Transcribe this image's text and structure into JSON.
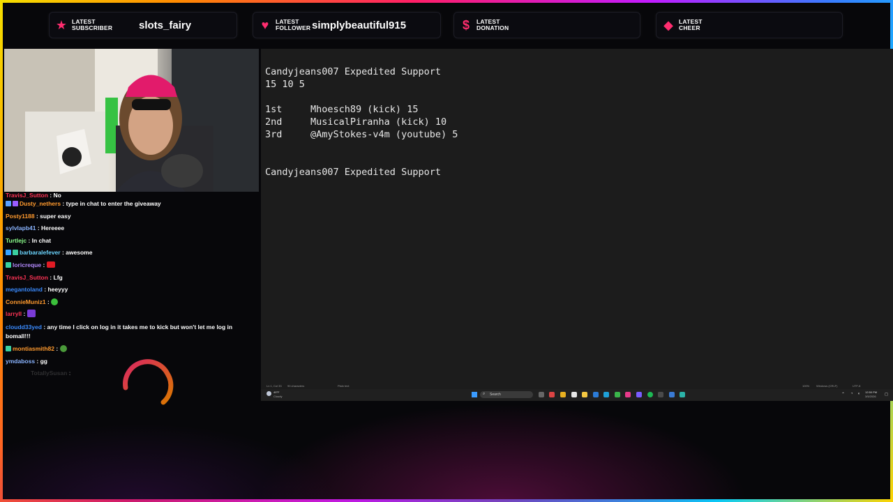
{
  "alerts": [
    {
      "icon": "star-icon",
      "label_line1": "LATEST",
      "label_line2": "SUBSCRIBER",
      "value": "slots_fairy"
    },
    {
      "icon": "heart-icon",
      "label_line1": "LATEST",
      "label_line2": "FOLLOWER",
      "value": "simplybeautiful915"
    },
    {
      "icon": "dollar-icon",
      "label_line1": "LATEST",
      "label_line2": "DONATION",
      "value": ""
    },
    {
      "icon": "diamond-icon",
      "label_line1": "LATEST",
      "label_line2": "CHEER",
      "value": ""
    }
  ],
  "chat": [
    {
      "user": "TravisJ_Sutton",
      "text": "No",
      "color": "#ff3355",
      "badges": []
    },
    {
      "user": "Dusty_nethers",
      "text": "type in chat to enter the giveaway",
      "color": "#ff9a2e",
      "badges": [
        "#5aa0ff",
        "#9b5cff"
      ]
    },
    {
      "user": "Posty1188",
      "text": "super easy",
      "color": "#ff9a2e",
      "badges": []
    },
    {
      "user": "sylvlapb41",
      "text": "Hereeee",
      "color": "#8ab4ff",
      "badges": []
    },
    {
      "user": "Turtlejc",
      "text": "In chat",
      "color": "#8cff8c",
      "badges": []
    },
    {
      "user": "barbaralefever",
      "text": "awesome",
      "color": "#6cd6ff",
      "badges": [
        "#36a3ff",
        "#3ad0a0"
      ]
    },
    {
      "user": "loricreque",
      "text": "",
      "color": "#b58bff",
      "badges": [
        "#3ad0a0"
      ]
    },
    {
      "user": "TravisJ_Sutton",
      "text": "Lfg",
      "color": "#ff3355",
      "badges": []
    },
    {
      "user": "megantoland",
      "text": "heeyyy",
      "color": "#3a8bff",
      "badges": []
    },
    {
      "user": "ConnieMuniz1",
      "text": "",
      "color": "#ff9a2e",
      "badges": []
    },
    {
      "user": "larryll",
      "text": "",
      "color": "#ff3355",
      "badges": []
    },
    {
      "user": "cloudd33yed",
      "text": "any time I click on log in it takes me to kick but won't let me log in bomall!!!",
      "color": "#3a8bff",
      "badges": []
    },
    {
      "user": "montiasmith82",
      "text": "",
      "color": "#ff9a2e",
      "badges": [
        "#3ad0a0"
      ]
    },
    {
      "user": "ymdaboss",
      "text": "gg",
      "color": "#8ab4ff",
      "badges": []
    },
    {
      "user": "TotallySusan",
      "text": "",
      "color": "#555555",
      "badges": []
    }
  ],
  "editor": {
    "lines": [
      "Candyjeans007 Expedited Support",
      "15 10 5",
      "",
      "1st     Mhoesch89 (kick) 15",
      "2nd     MusicalPiranha (kick) 10",
      "3rd     @AmyStokes-v4m (youtube) 5",
      "",
      "",
      "Candyjeans007 Expedited Support"
    ]
  },
  "statusbar": {
    "position": "Ln 1, Col 33",
    "chars": "90 characters",
    "format": "Plain text",
    "zoom": "100%",
    "line_endings": "Windows (CRLF)",
    "encoding": "UTF-8"
  },
  "taskbar": {
    "weather_temp": "49°F",
    "weather_desc": "Cloudy",
    "search": "Search",
    "time": "12:50 PM",
    "date": "3/5/2026"
  }
}
